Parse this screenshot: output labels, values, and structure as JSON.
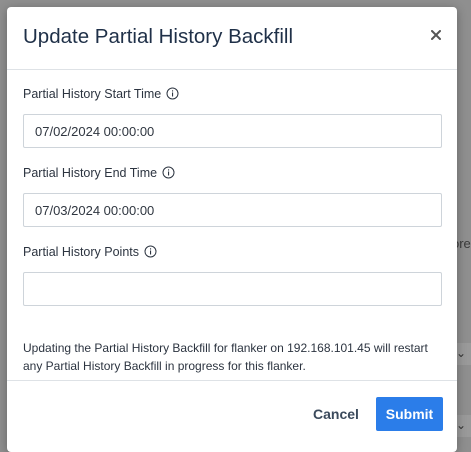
{
  "modal": {
    "title": "Update Partial History Backfill",
    "close_icon": "close-icon"
  },
  "fields": {
    "start_time": {
      "label": "Partial History Start Time",
      "value": "07/02/2024 00:00:00",
      "icon": "info-icon"
    },
    "end_time": {
      "label": "Partial History End Time",
      "value": "07/03/2024 00:00:00",
      "icon": "info-icon"
    },
    "points": {
      "label": "Partial History Points",
      "value": "",
      "icon": "info-icon"
    }
  },
  "help_text": "Updating the Partial History Backfill for flanker on 192.168.101.45 will restart any Partial History Backfill in progress for this flanker.",
  "footer": {
    "cancel_label": "Cancel",
    "submit_label": "Submit"
  },
  "background": {
    "partial_text": "ore",
    "chevron_icon": "chevron-down-icon"
  },
  "colors": {
    "primary": "#2b7de9",
    "title": "#1f3048",
    "overlay": "#8f8f8f"
  }
}
